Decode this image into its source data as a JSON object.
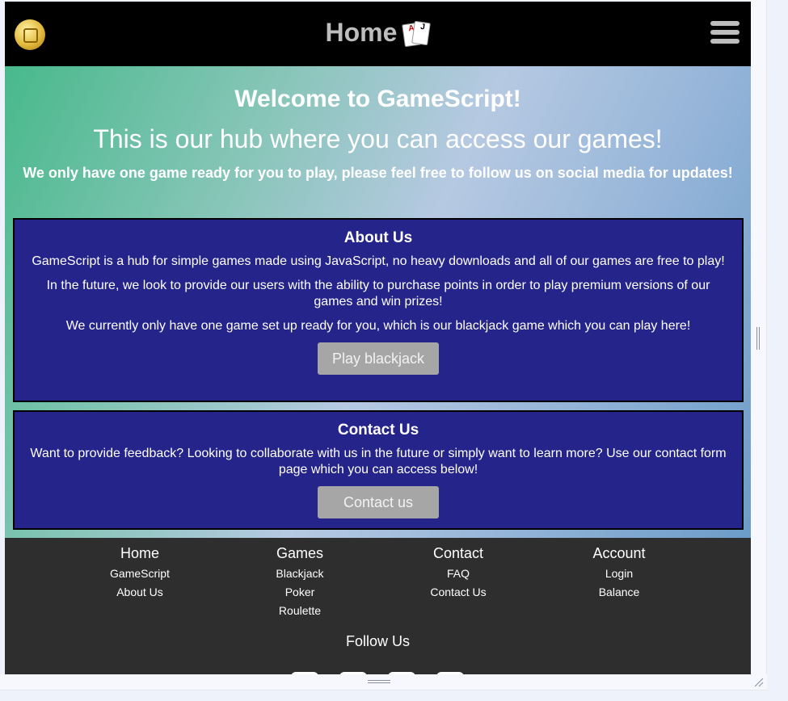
{
  "header": {
    "title": "Home",
    "cards_icon": "playing-cards-icon",
    "card_ranks": [
      "A",
      "J"
    ],
    "logo_icon": "gamescript-coin-logo",
    "menu_icon": "hamburger-menu-icon"
  },
  "hero": {
    "heading": "Welcome to GameScript!",
    "subheading": "This is our hub where you can access our games!",
    "notice": "We only have one game ready for you to play, please feel free to follow us on social media for updates!"
  },
  "about": {
    "title": "About Us",
    "p1": "GameScript is a hub for simple games made using JavaScript, no heavy downloads and all of our games are free to play!",
    "p2": "In the future, we look to provide our users with the ability to purchase points in order to play premium versions of our games and win prizes!",
    "p3": "We currently only have one game set up ready for you, which is our blackjack game which you can play here!",
    "button": "Play blackjack"
  },
  "contact": {
    "title": "Contact Us",
    "p1": "Want to provide feedback? Looking to collaborate with us in the future or simply want to learn more? Use our contact form page which you can access below!",
    "button": "Contact us"
  },
  "footer": {
    "columns": [
      {
        "heading": "Home",
        "links": [
          "GameScript",
          "About Us"
        ]
      },
      {
        "heading": "Games",
        "links": [
          "Blackjack",
          "Poker",
          "Roulette"
        ]
      },
      {
        "heading": "Contact",
        "links": [
          "FAQ",
          "Contact Us"
        ]
      },
      {
        "heading": "Account",
        "links": [
          "Login",
          "Balance"
        ]
      }
    ],
    "follow_label": "Follow Us",
    "social_icons": [
      "social-icon-1",
      "social-icon-2",
      "social-icon-3",
      "social-icon-4"
    ]
  },
  "colors": {
    "header_bg": "#000000",
    "panel_bg": "#24248a",
    "footer_bg": "#2e2e2e",
    "button_bg": "#a6a6a6"
  }
}
